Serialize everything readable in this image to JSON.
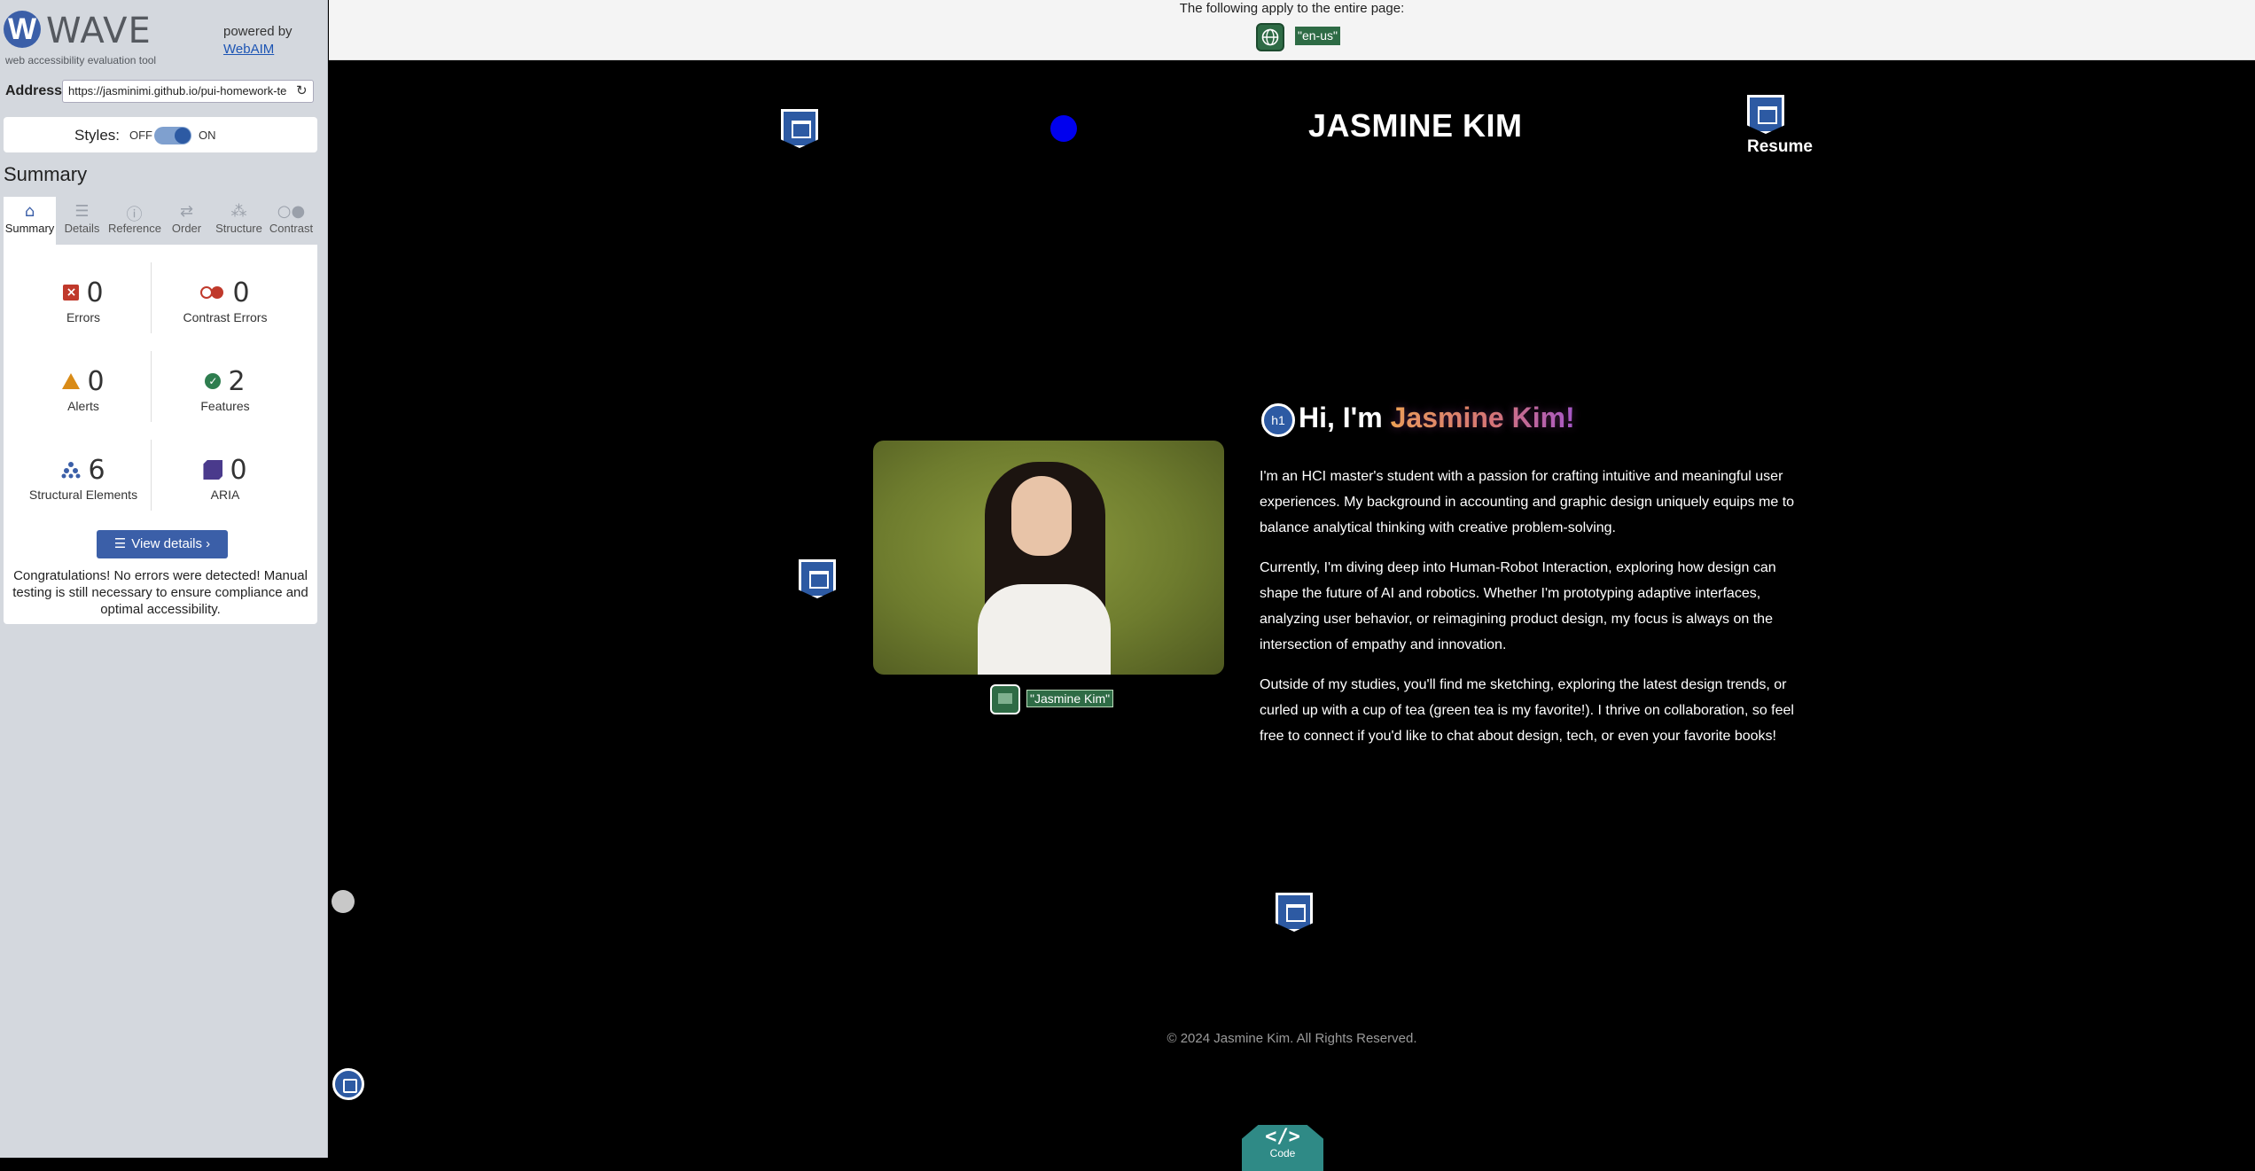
{
  "sidebar": {
    "logo_letter": "W",
    "logo_name": "WAVE",
    "logo_subtitle": "web accessibility evaluation tool",
    "powered_by": "powered by",
    "powered_link": "WebAIM",
    "address_label": "Address:",
    "address_value": "https://jasminimi.github.io/pui-homework-te",
    "styles_label": "Styles:",
    "styles_off": "OFF",
    "styles_on": "ON",
    "styles_enabled": true,
    "summary_heading": "Summary",
    "tabs": [
      {
        "label": "Summary",
        "icon": "home-icon",
        "active": true
      },
      {
        "label": "Details",
        "icon": "list-icon",
        "active": false
      },
      {
        "label": "Reference",
        "icon": "info-icon",
        "active": false
      },
      {
        "label": "Order",
        "icon": "order-icon",
        "active": false
      },
      {
        "label": "Structure",
        "icon": "structure-icon",
        "active": false
      },
      {
        "label": "Contrast",
        "icon": "contrast-icon",
        "active": false
      }
    ],
    "stats": {
      "errors": {
        "value": "0",
        "label": "Errors"
      },
      "contrast_errors": {
        "value": "0",
        "label": "Contrast Errors"
      },
      "alerts": {
        "value": "0",
        "label": "Alerts"
      },
      "features": {
        "value": "2",
        "label": "Features"
      },
      "structural": {
        "value": "6",
        "label": "Structural Elements"
      },
      "aria": {
        "value": "0",
        "label": "ARIA"
      }
    },
    "view_details": "View details ›",
    "congrats": "Congratulations! No errors were detected! Manual testing is still necessary to ensure compliance and optimal accessibility."
  },
  "topbar": {
    "text": "The following apply to the entire page:",
    "lang_tag": "\"en-us\""
  },
  "page": {
    "site_title": "JASMINE KIM",
    "resume_label": "Resume",
    "heading_prefix": "Hi, I'm ",
    "heading_name": "Jasmine Kim!",
    "h1_badge": "h1",
    "image_alt_tag": "\"Jasmine Kim\"",
    "paragraphs": [
      "I'm an HCI master's student with a passion for crafting intuitive and meaningful user experiences. My background in accounting and graphic design uniquely equips me to balance analytical thinking with creative problem-solving.",
      "Currently, I'm diving deep into Human-Robot Interaction, exploring how design can shape the future of AI and robotics. Whether I'm prototyping adaptive interfaces, analyzing user behavior, or reimagining product design, my focus is always on the intersection of empathy and innovation.",
      "Outside of my studies, you'll find me sketching, exploring the latest design trends, or curled up with a cup of tea (green tea is my favorite!). I thrive on collaboration, so feel free to connect if you'd like to chat about design, tech, or even your favorite books!"
    ],
    "footer": "© 2024 Jasmine Kim. All Rights Reserved.",
    "code_badge_glyph": "</>",
    "code_badge_label": "Code"
  },
  "colors": {
    "wave_blue": "#3b5fa8",
    "feature_green": "#2e6b45",
    "error_red": "#c0392b",
    "alert_orange": "#d98b17",
    "aria_purple": "#4a3a8c",
    "page_background": "#000000"
  }
}
